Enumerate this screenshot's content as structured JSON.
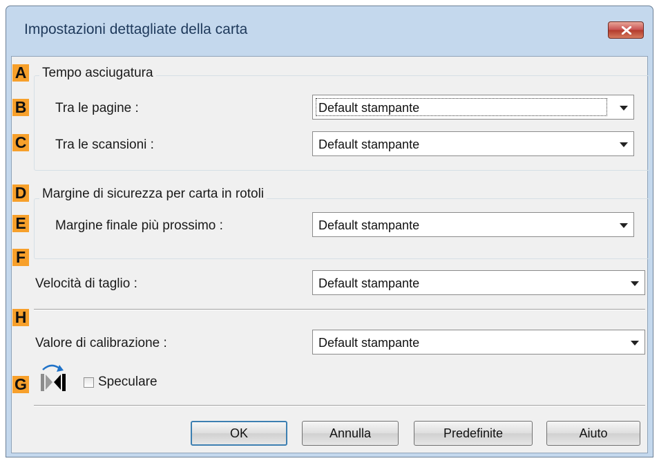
{
  "window": {
    "title": "Impostazioni dettagliate della carta"
  },
  "markers": {
    "A": "A",
    "B": "B",
    "C": "C",
    "D": "D",
    "E": "E",
    "F": "F",
    "H": "H",
    "G": "G"
  },
  "drying_time": {
    "label": "Tempo asciugatura",
    "between_pages": {
      "label": "Tra le pagine :",
      "value": "Default stampante"
    },
    "between_scans": {
      "label": "Tra le scansioni :",
      "value": "Default stampante"
    }
  },
  "roll_margin": {
    "label": "Margine di sicurezza per carta in rotoli",
    "near_end_margin": {
      "label": "Margine finale più prossimo :",
      "value": "Default stampante"
    }
  },
  "cut_speed": {
    "label": "Velocità di taglio :",
    "value": "Default stampante"
  },
  "calibration": {
    "label": "Valore di calibrazione :",
    "value": "Default stampante"
  },
  "mirror": {
    "label": "Speculare",
    "checked": false,
    "icon": "mirror-image-icon"
  },
  "buttons": {
    "ok": "OK",
    "cancel": "Annulla",
    "defaults": "Predefinite",
    "help": "Aiuto"
  },
  "colors": {
    "marker": "#f7a02b",
    "titlebar": "#c4d8ed",
    "close": "#c75050",
    "default_button_border": "#3c7fb1"
  }
}
